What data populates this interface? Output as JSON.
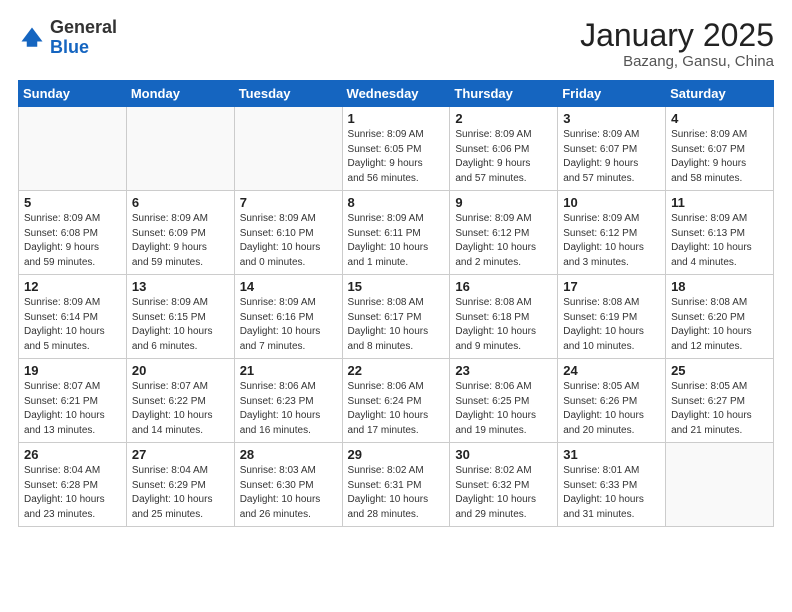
{
  "header": {
    "logo_general": "General",
    "logo_blue": "Blue",
    "month_title": "January 2025",
    "location": "Bazang, Gansu, China"
  },
  "weekdays": [
    "Sunday",
    "Monday",
    "Tuesday",
    "Wednesday",
    "Thursday",
    "Friday",
    "Saturday"
  ],
  "weeks": [
    [
      {
        "day": "",
        "info": ""
      },
      {
        "day": "",
        "info": ""
      },
      {
        "day": "",
        "info": ""
      },
      {
        "day": "1",
        "info": "Sunrise: 8:09 AM\nSunset: 6:05 PM\nDaylight: 9 hours\nand 56 minutes."
      },
      {
        "day": "2",
        "info": "Sunrise: 8:09 AM\nSunset: 6:06 PM\nDaylight: 9 hours\nand 57 minutes."
      },
      {
        "day": "3",
        "info": "Sunrise: 8:09 AM\nSunset: 6:07 PM\nDaylight: 9 hours\nand 57 minutes."
      },
      {
        "day": "4",
        "info": "Sunrise: 8:09 AM\nSunset: 6:07 PM\nDaylight: 9 hours\nand 58 minutes."
      }
    ],
    [
      {
        "day": "5",
        "info": "Sunrise: 8:09 AM\nSunset: 6:08 PM\nDaylight: 9 hours\nand 59 minutes."
      },
      {
        "day": "6",
        "info": "Sunrise: 8:09 AM\nSunset: 6:09 PM\nDaylight: 9 hours\nand 59 minutes."
      },
      {
        "day": "7",
        "info": "Sunrise: 8:09 AM\nSunset: 6:10 PM\nDaylight: 10 hours\nand 0 minutes."
      },
      {
        "day": "8",
        "info": "Sunrise: 8:09 AM\nSunset: 6:11 PM\nDaylight: 10 hours\nand 1 minute."
      },
      {
        "day": "9",
        "info": "Sunrise: 8:09 AM\nSunset: 6:12 PM\nDaylight: 10 hours\nand 2 minutes."
      },
      {
        "day": "10",
        "info": "Sunrise: 8:09 AM\nSunset: 6:12 PM\nDaylight: 10 hours\nand 3 minutes."
      },
      {
        "day": "11",
        "info": "Sunrise: 8:09 AM\nSunset: 6:13 PM\nDaylight: 10 hours\nand 4 minutes."
      }
    ],
    [
      {
        "day": "12",
        "info": "Sunrise: 8:09 AM\nSunset: 6:14 PM\nDaylight: 10 hours\nand 5 minutes."
      },
      {
        "day": "13",
        "info": "Sunrise: 8:09 AM\nSunset: 6:15 PM\nDaylight: 10 hours\nand 6 minutes."
      },
      {
        "day": "14",
        "info": "Sunrise: 8:09 AM\nSunset: 6:16 PM\nDaylight: 10 hours\nand 7 minutes."
      },
      {
        "day": "15",
        "info": "Sunrise: 8:08 AM\nSunset: 6:17 PM\nDaylight: 10 hours\nand 8 minutes."
      },
      {
        "day": "16",
        "info": "Sunrise: 8:08 AM\nSunset: 6:18 PM\nDaylight: 10 hours\nand 9 minutes."
      },
      {
        "day": "17",
        "info": "Sunrise: 8:08 AM\nSunset: 6:19 PM\nDaylight: 10 hours\nand 10 minutes."
      },
      {
        "day": "18",
        "info": "Sunrise: 8:08 AM\nSunset: 6:20 PM\nDaylight: 10 hours\nand 12 minutes."
      }
    ],
    [
      {
        "day": "19",
        "info": "Sunrise: 8:07 AM\nSunset: 6:21 PM\nDaylight: 10 hours\nand 13 minutes."
      },
      {
        "day": "20",
        "info": "Sunrise: 8:07 AM\nSunset: 6:22 PM\nDaylight: 10 hours\nand 14 minutes."
      },
      {
        "day": "21",
        "info": "Sunrise: 8:06 AM\nSunset: 6:23 PM\nDaylight: 10 hours\nand 16 minutes."
      },
      {
        "day": "22",
        "info": "Sunrise: 8:06 AM\nSunset: 6:24 PM\nDaylight: 10 hours\nand 17 minutes."
      },
      {
        "day": "23",
        "info": "Sunrise: 8:06 AM\nSunset: 6:25 PM\nDaylight: 10 hours\nand 19 minutes."
      },
      {
        "day": "24",
        "info": "Sunrise: 8:05 AM\nSunset: 6:26 PM\nDaylight: 10 hours\nand 20 minutes."
      },
      {
        "day": "25",
        "info": "Sunrise: 8:05 AM\nSunset: 6:27 PM\nDaylight: 10 hours\nand 21 minutes."
      }
    ],
    [
      {
        "day": "26",
        "info": "Sunrise: 8:04 AM\nSunset: 6:28 PM\nDaylight: 10 hours\nand 23 minutes."
      },
      {
        "day": "27",
        "info": "Sunrise: 8:04 AM\nSunset: 6:29 PM\nDaylight: 10 hours\nand 25 minutes."
      },
      {
        "day": "28",
        "info": "Sunrise: 8:03 AM\nSunset: 6:30 PM\nDaylight: 10 hours\nand 26 minutes."
      },
      {
        "day": "29",
        "info": "Sunrise: 8:02 AM\nSunset: 6:31 PM\nDaylight: 10 hours\nand 28 minutes."
      },
      {
        "day": "30",
        "info": "Sunrise: 8:02 AM\nSunset: 6:32 PM\nDaylight: 10 hours\nand 29 minutes."
      },
      {
        "day": "31",
        "info": "Sunrise: 8:01 AM\nSunset: 6:33 PM\nDaylight: 10 hours\nand 31 minutes."
      },
      {
        "day": "",
        "info": ""
      }
    ]
  ]
}
